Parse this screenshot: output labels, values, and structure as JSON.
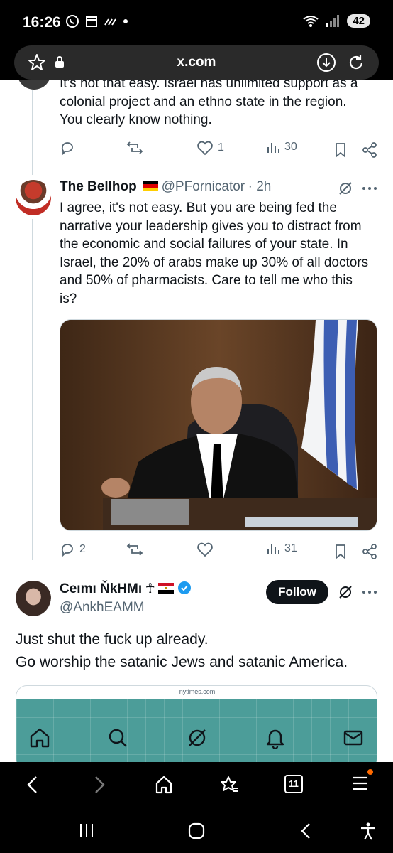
{
  "status_bar": {
    "time": "16:26",
    "battery": "42",
    "left_icons": [
      "whatsapp-icon",
      "calendar-icon",
      "signal-slashes-icon",
      "dot-icon"
    ],
    "right_icons": [
      "wifi-icon",
      "cell-signal-icon"
    ]
  },
  "browser": {
    "url": "x.com"
  },
  "tweets": [
    {
      "text_lines": [
        "It's not that easy. Israel has unlimited support as a",
        "colonial project and an ethno state in the region.",
        "You clearly know nothing."
      ],
      "replies": "",
      "reposts": "",
      "likes": "1",
      "views": "30"
    },
    {
      "name": "The Bellhop",
      "handle": "@PFornicator",
      "time": "· 2h",
      "text_lines": [
        "I agree, it's not easy. But you are being fed the",
        "narrative your leadership gives you to distract from",
        "the economic and social failures of your state. In",
        "Israel, the 20% of arabs make up 30% of all doctors",
        "and 50% of pharmacists. Care to tell me who this",
        "is?"
      ],
      "replies": "2",
      "reposts": "",
      "likes": "",
      "views": "31"
    },
    {
      "name": "Ceımı ŇkHMı",
      "symbol": "☥",
      "handle": "@AnkhEAMM",
      "follow_label": "Follow",
      "text_lines": [
        "Just shut the fuck up already.",
        "Go worship the satanic Jews and satanic America."
      ],
      "card_domain": "nytimes.com"
    }
  ],
  "browser_nav": {
    "tab_count": "11"
  },
  "colors": {
    "accent": "#1d9bf0",
    "text": "#0f1419",
    "muted": "#536471"
  }
}
